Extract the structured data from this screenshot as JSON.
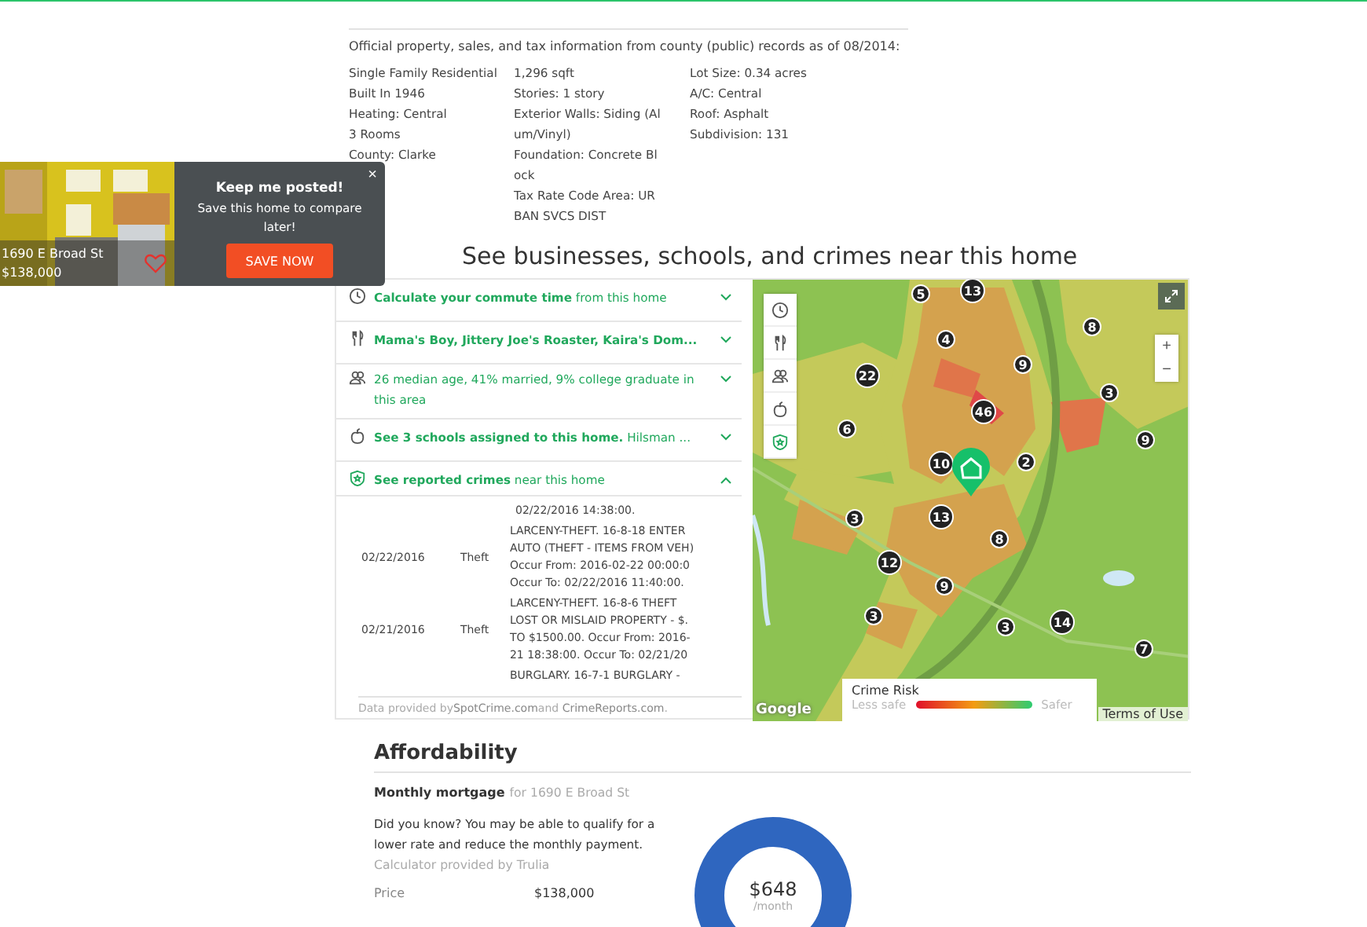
{
  "public_records": {
    "intro": "Official property, sales, and tax information from county (public) records as of 08/2014:",
    "columns": [
      [
        "Single Family Residential",
        "Built In 1946",
        "Heating: Central",
        "3 Rooms",
        "County: Clarke"
      ],
      [
        "1,296 sqft",
        "Stories: 1 story",
        "Exterior Walls: Siding (Al",
        "um/Vinyl)",
        "Foundation: Concrete Bl",
        "ock",
        "Tax Rate Code Area: UR",
        "BAN SVCS DIST"
      ],
      [
        "Lot Size: 0.34 acres",
        "A/C: Central",
        "Roof: Asphalt",
        "Subdivision: 131"
      ]
    ]
  },
  "save_popup": {
    "address": "1690 E Broad St",
    "price": "$138,000",
    "favorited": false,
    "title": "Keep me posted!",
    "message": "Save this home to compare later!",
    "button": "SAVE NOW",
    "close": "×"
  },
  "nearby": {
    "heading": "See businesses, schools, and crimes near this home",
    "sections": [
      {
        "kind": "commute",
        "title": "Calculate your commute time",
        "subtitle": "from this home",
        "expanded": false
      },
      {
        "kind": "food",
        "title": "Mama's Boy, Jittery Joe's Roaster, Kaira's Dom...",
        "expanded": false
      },
      {
        "kind": "people",
        "subtitle": "26 median age, 41% married, 9% college graduate in this area",
        "expanded": false
      },
      {
        "kind": "school",
        "title": "See 3 schools assigned to this home.",
        "subtitle": "Hilsman ...",
        "expanded": false
      },
      {
        "kind": "crime",
        "title": "See reported crimes",
        "subtitle": "near this home",
        "expanded": true
      }
    ],
    "crimes": {
      "lead": "02/22/2016 14:38:00.",
      "rows": [
        {
          "date": "02/22/2016",
          "type": "Theft",
          "lines": [
            "LARCENY-THEFT. 16-8-18 ENTER",
            "AUTO (THEFT - ITEMS FROM VEH)",
            "Occur From: 2016-02-22 00:00:0",
            "Occur To: 02/22/2016 11:40:00."
          ]
        },
        {
          "date": "02/21/2016",
          "type": "Theft",
          "lines": [
            "LARCENY-THEFT. 16-8-6 THEFT",
            "LOST OR MISLAID PROPERTY - $.",
            "TO $1500.00. Occur From: 2016-",
            "21 18:38:00. Occur To: 02/21/20"
          ]
        },
        {
          "lines": [
            "BURGLARY. 16-7-1 BURGLARY -"
          ]
        }
      ]
    },
    "credit": {
      "prefix": "Data provided by",
      "links": [
        "SpotCrime.com",
        "CrimeReports.com"
      ],
      "joiner": "and",
      "suffix": "."
    },
    "map": {
      "tools": [
        {
          "kind": "commute",
          "selected": false
        },
        {
          "kind": "food",
          "selected": false
        },
        {
          "kind": "people",
          "selected": false
        },
        {
          "kind": "school",
          "selected": false
        },
        {
          "kind": "crime",
          "selected": true
        }
      ],
      "markers": [
        {
          "count": "5"
        },
        {
          "count": "13"
        },
        {
          "count": "8"
        },
        {
          "count": "4"
        },
        {
          "count": "9"
        },
        {
          "count": "22"
        },
        {
          "count": "3"
        },
        {
          "count": "46"
        },
        {
          "count": "6"
        },
        {
          "count": "9"
        },
        {
          "count": "10"
        },
        {
          "count": "2"
        },
        {
          "count": "3"
        },
        {
          "count": "13"
        },
        {
          "count": "8"
        },
        {
          "count": "12"
        },
        {
          "count": "9"
        },
        {
          "count": "3"
        },
        {
          "count": "3"
        },
        {
          "count": "14"
        },
        {
          "count": "7"
        }
      ],
      "zoom_in": "+",
      "zoom_out": "−",
      "legend": {
        "title": "Crime Risk",
        "low": "Less safe",
        "high": "Safer"
      },
      "attribution": "Google",
      "terms": "Terms of Use"
    }
  },
  "affordability": {
    "title": "Affordability",
    "subtitle": "Monthly mortgage",
    "subtitle_note": "for 1690 E Broad St",
    "note": "Did you know? You may be able to qualify for a lower rate and reduce the monthly payment.",
    "provider": "Calculator provided by Trulia",
    "rows": [
      {
        "label": "Price",
        "value": "$138,000"
      }
    ],
    "payment": {
      "amount": "$648",
      "unit": "/month"
    }
  }
}
